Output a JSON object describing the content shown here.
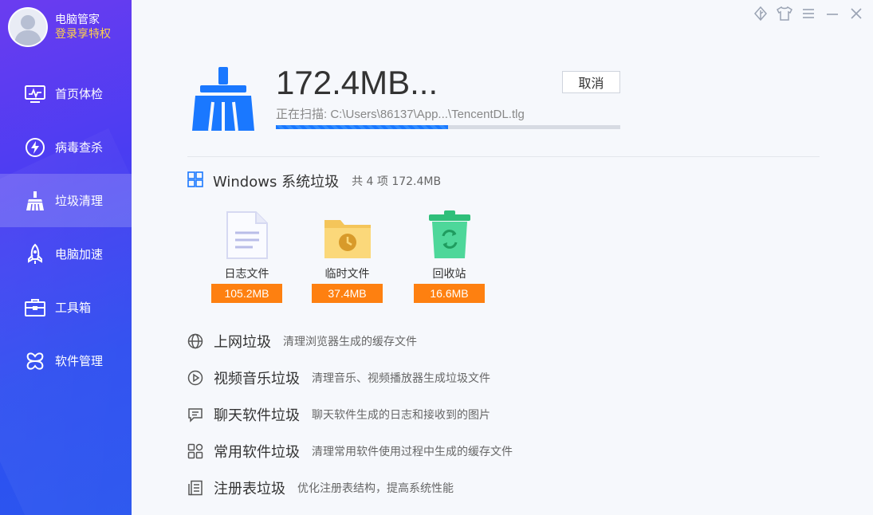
{
  "user": {
    "name": "电脑管家",
    "login": "登录享特权"
  },
  "nav": [
    {
      "label": "首页体检",
      "icon": "monitor-icon"
    },
    {
      "label": "病毒查杀",
      "icon": "lightning-shield-icon"
    },
    {
      "label": "垃圾清理",
      "icon": "broom-icon",
      "active": true
    },
    {
      "label": "电脑加速",
      "icon": "rocket-icon"
    },
    {
      "label": "工具箱",
      "icon": "toolbox-icon"
    },
    {
      "label": "软件管理",
      "icon": "app-manager-icon"
    }
  ],
  "window_controls": [
    "leaf-icon",
    "tshirt-icon",
    "menu-icon",
    "minimize-icon",
    "close-icon"
  ],
  "scan": {
    "size": "172.4MB...",
    "cancel_label": "取消",
    "path": "正在扫描:  C:\\Users\\86137\\App...\\TencentDL.tlg",
    "progress": 0.5
  },
  "section": {
    "title": "Windows 系统垃圾",
    "summary": "共 4 项 172.4MB"
  },
  "files": [
    {
      "label": "日志文件",
      "size": "105.2MB",
      "icon": "log-file-icon"
    },
    {
      "label": "临时文件",
      "size": "37.4MB",
      "icon": "temp-folder-icon"
    },
    {
      "label": "回收站",
      "size": "16.6MB",
      "icon": "recycle-bin-icon"
    }
  ],
  "categories": [
    {
      "title": "上网垃圾",
      "desc": "清理浏览器生成的缓存文件",
      "icon": "globe-icon"
    },
    {
      "title": "视频音乐垃圾",
      "desc": "清理音乐、视频播放器生成垃圾文件",
      "icon": "play-icon"
    },
    {
      "title": "聊天软件垃圾",
      "desc": "聊天软件生成的日志和接收到的图片",
      "icon": "chat-icon"
    },
    {
      "title": "常用软件垃圾",
      "desc": "清理常用软件使用过程中生成的缓存文件",
      "icon": "apps-grid-icon"
    },
    {
      "title": "注册表垃圾",
      "desc": "优化注册表结构，提高系统性能",
      "icon": "registry-icon"
    }
  ],
  "colors": {
    "accent": "#1a78ff",
    "badge": "#fe8010",
    "highlight": "#ffd24a"
  }
}
